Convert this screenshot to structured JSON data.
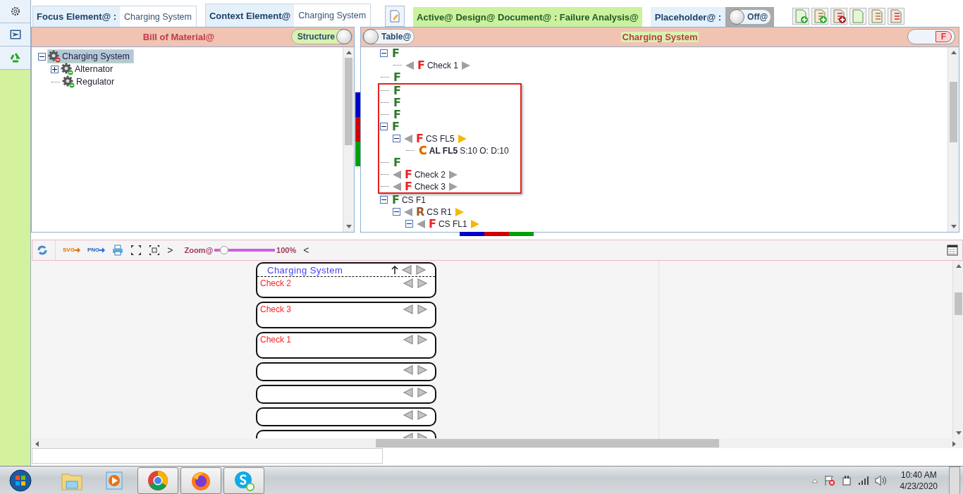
{
  "top_bar": {
    "focus_label": "Focus Element@ :",
    "focus_value": "Charging System",
    "context_label": "Context Element@",
    "context_value": "Charging System",
    "active_document": "Active@ Design@ Document@ : Failure Analysis@",
    "placeholder_label": "Placeholder@ :",
    "placeholder_toggle": {
      "label": "Off@",
      "on": false
    }
  },
  "bom_panel": {
    "title": "Bill of Material@",
    "view_toggle": {
      "label": "Structure",
      "on": true
    },
    "tree": [
      {
        "label": "Charging System",
        "selected": true,
        "expanded": true,
        "children": [
          {
            "label": "Alternator",
            "selected": false,
            "expanded": false
          },
          {
            "label": "Regulator",
            "selected": false
          }
        ]
      }
    ]
  },
  "analysis_panel": {
    "view_toggle": {
      "label": "Table@",
      "on": false
    },
    "title": "Charging System",
    "filter_toggle": {
      "label": "F",
      "on": true
    },
    "tree": [
      {
        "kind": "function",
        "letter": "F",
        "expanded": true,
        "children": [
          {
            "kind": "failure",
            "letter": "F",
            "label": "Check 1",
            "prev_arrow": {
              "color": "#a0a0a0"
            },
            "next_arrow": {
              "color": "#a0a0a0"
            }
          }
        ]
      },
      {
        "kind": "function",
        "letter": "F"
      },
      {
        "kind": "highlight_group",
        "children": [
          {
            "kind": "function",
            "letter": "F"
          },
          {
            "kind": "function",
            "letter": "F"
          },
          {
            "kind": "function",
            "letter": "F"
          },
          {
            "kind": "function",
            "letter": "F",
            "expanded": true,
            "children": [
              {
                "kind": "failure",
                "letter": "F",
                "label": "CS FL5",
                "prev_arrow": {
                  "color": "#a0a0a0"
                },
                "next_arrow": {
                  "color": "#f5b800"
                },
                "expanded": true,
                "children": [
                  {
                    "kind": "cause",
                    "letter": "C",
                    "label": "AL FL5",
                    "ratings": "S:10 O: D:10"
                  }
                ]
              }
            ]
          },
          {
            "kind": "function",
            "letter": "F"
          },
          {
            "kind": "failure",
            "letter": "F",
            "label": "Check 2",
            "prev_arrow": {
              "color": "#a0a0a0"
            },
            "next_arrow": {
              "color": "#a0a0a0"
            }
          },
          {
            "kind": "failure",
            "letter": "F",
            "label": "Check 3",
            "prev_arrow": {
              "color": "#a0a0a0"
            },
            "next_arrow": {
              "color": "#a0a0a0"
            }
          }
        ]
      },
      {
        "kind": "function",
        "letter": "F",
        "label": "CS F1",
        "expanded": true,
        "children": [
          {
            "kind": "requirement",
            "letter": "R",
            "label": "CS R1",
            "prev_arrow": {
              "color": "#a0a0a0"
            },
            "next_arrow": {
              "color": "#f5b800"
            },
            "expanded": true,
            "children": [
              {
                "kind": "failure",
                "letter": "F",
                "label": "CS FL1",
                "prev_arrow": {
                  "color": "#a0a0a0"
                },
                "next_arrow": {
                  "color": "#f5b800"
                },
                "expanded": true
              }
            ]
          }
        ]
      }
    ]
  },
  "diagram_toolbar": {
    "svg_label": "SVG",
    "png_label": "PNG",
    "next_glyph": ">",
    "zoom_label": "Zoom@",
    "zoom": {
      "level": 0.1
    },
    "zoom_reading": "100%",
    "prev_glyph": "<"
  },
  "diagram": {
    "cards": [
      {
        "kind": "header",
        "title": "Charging System",
        "label": "Check 2"
      },
      {
        "kind": "check",
        "label": "Check 3"
      },
      {
        "kind": "check",
        "label": "Check 1"
      },
      {
        "kind": "empty"
      },
      {
        "kind": "empty"
      },
      {
        "kind": "empty"
      },
      {
        "kind": "empty"
      }
    ]
  },
  "taskbar": {
    "apps": [
      {
        "kind": "explorer",
        "running": false
      },
      {
        "kind": "media",
        "running": false
      },
      {
        "kind": "chrome",
        "running": true
      },
      {
        "kind": "firefox",
        "running": true
      },
      {
        "kind": "skype",
        "running": true
      }
    ],
    "time": "10:40 AM",
    "date": "4/23/2020"
  }
}
